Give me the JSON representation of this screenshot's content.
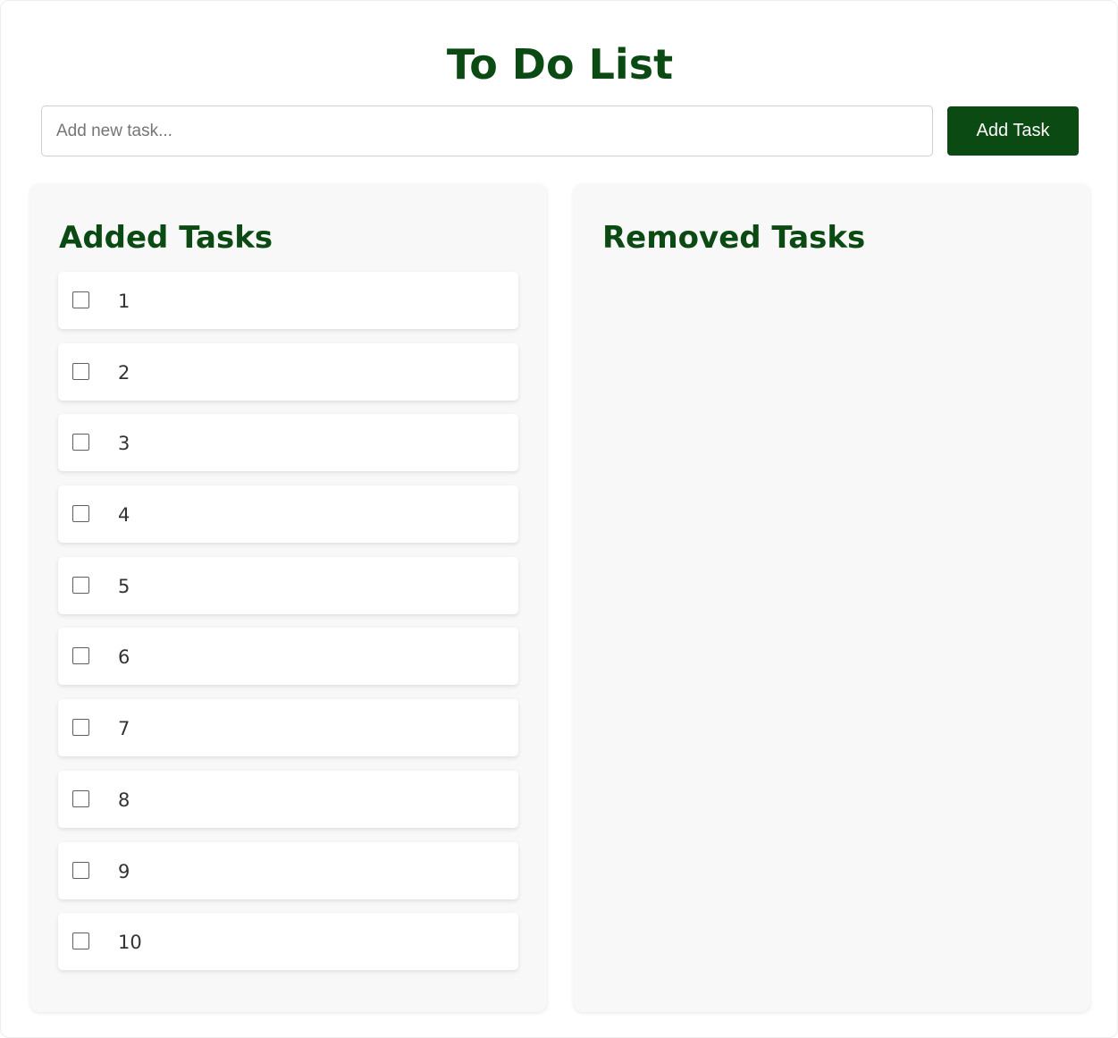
{
  "app": {
    "title": "To Do List"
  },
  "input": {
    "placeholder": "Add new task...",
    "value": ""
  },
  "add_button": {
    "label": "Add Task"
  },
  "added_panel": {
    "heading": "Added Tasks",
    "tasks": [
      {
        "text": "1",
        "checked": false
      },
      {
        "text": "2",
        "checked": false
      },
      {
        "text": "3",
        "checked": false
      },
      {
        "text": "4",
        "checked": false
      },
      {
        "text": "5",
        "checked": false
      },
      {
        "text": "6",
        "checked": false
      },
      {
        "text": "7",
        "checked": false
      },
      {
        "text": "8",
        "checked": false
      },
      {
        "text": "9",
        "checked": false
      },
      {
        "text": "10",
        "checked": false
      }
    ]
  },
  "removed_panel": {
    "heading": "Removed Tasks",
    "tasks": []
  },
  "colors": {
    "accent": "#0b4a12",
    "panel_background": "#f8f8f8",
    "card_background": "#ffffff",
    "text": "#333333"
  }
}
